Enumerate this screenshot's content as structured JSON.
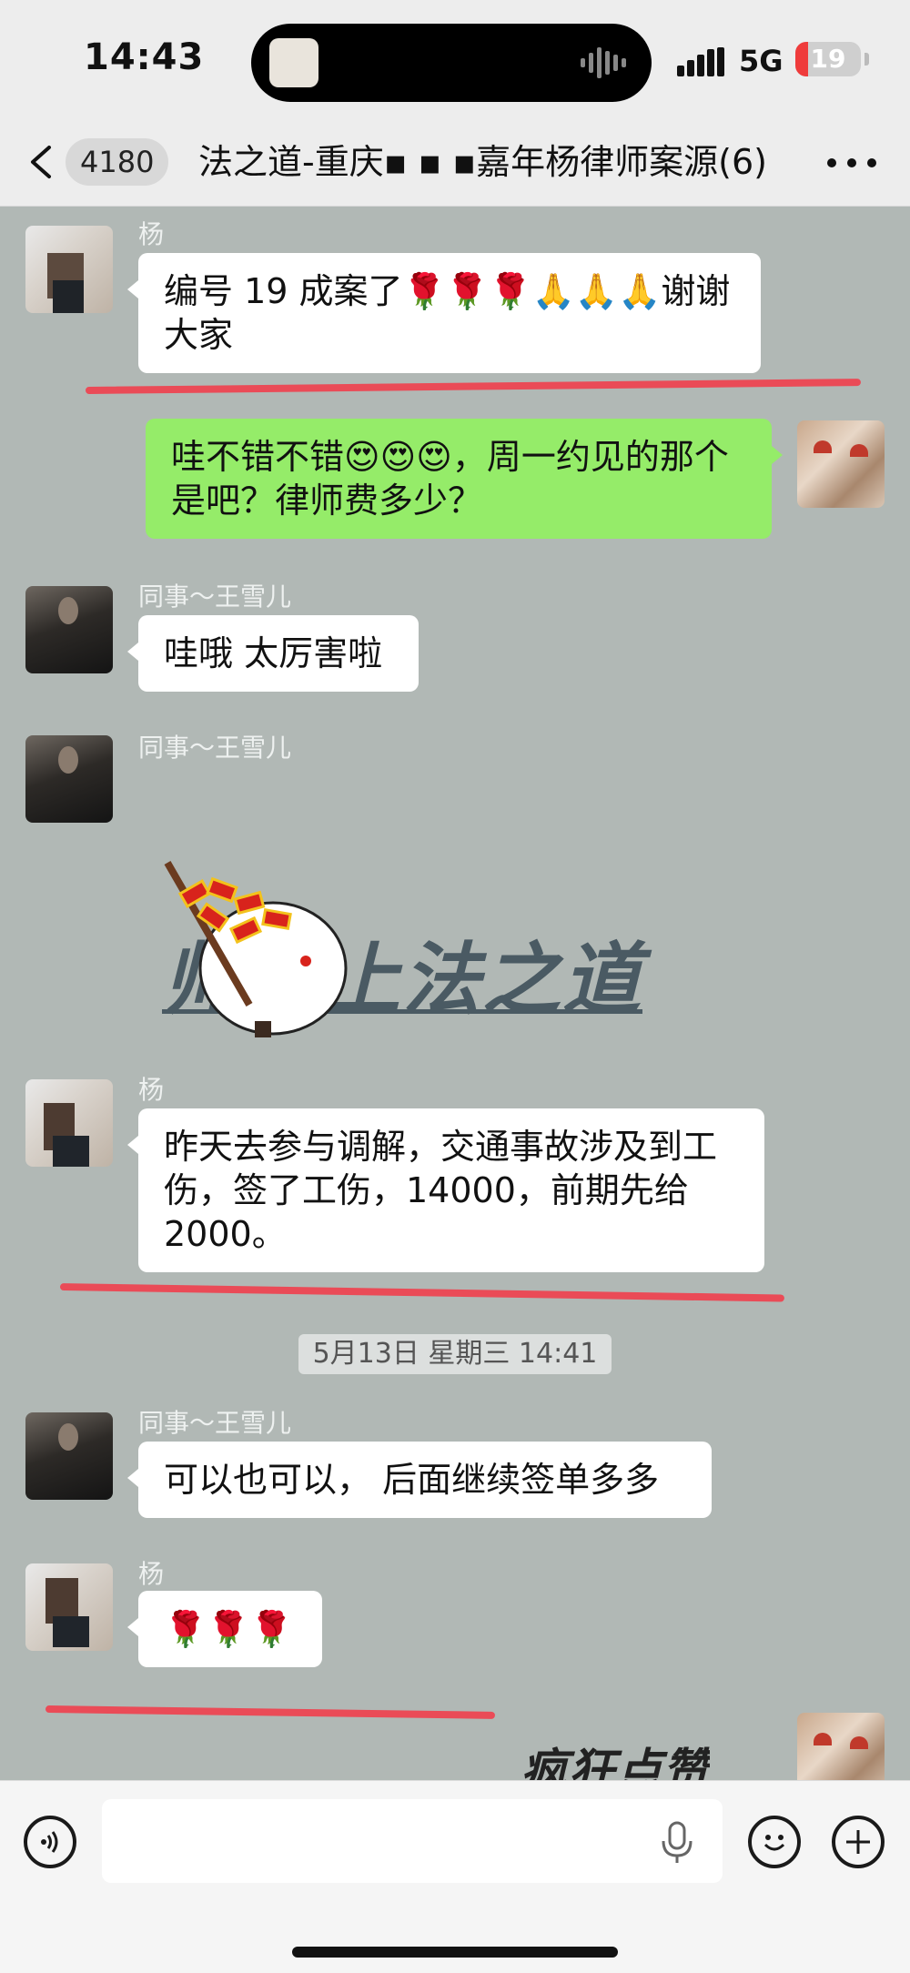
{
  "status_bar": {
    "time": "14:43",
    "network": "5G",
    "battery": "19",
    "battery_level_percent": 19
  },
  "nav": {
    "unread_count": "4180",
    "title": "法之道-重庆▪ ▪ ▪嘉年杨律师案源(6)",
    "back_icon": "chevron-left-icon",
    "more_icon": "more-dots-icon"
  },
  "messages": [
    {
      "sender": "杨",
      "text": "编号 19 成案了🌹🌹🌹🙏🙏🙏谢谢大家"
    },
    {
      "text": "哇不错不错😍😍😍，周一约见的那个是吧？律师费多少？"
    },
    {
      "sender": "同事～王雪儿",
      "text": "哇哦 太厉害啦"
    },
    {
      "sender": "同事～王雪儿",
      "sticker_text": "师就上法之道",
      "sticker_icon": "firecracker-sticker-icon"
    },
    {
      "sender": "杨",
      "text": "昨天去参与调解，交通事故涉及到工伤，签了工伤，14000，前期先给2000。"
    },
    {
      "sender": "同事～王雪儿",
      "text": "可以也可以， 后面继续签单多多"
    },
    {
      "sender": "杨",
      "text": "🌹🌹🌹"
    },
    {
      "sticker_text": "疯狂点赞"
    }
  ],
  "timestamp": "5月13日 星期三 14:41",
  "input_bar": {
    "voice_icon": "voice-icon",
    "mic_icon": "mic-icon",
    "emoji_icon": "emoji-icon",
    "plus_icon": "plus-icon"
  },
  "colors": {
    "chat_background": "#b1b8b5",
    "self_bubble": "#95ec69",
    "annotation_line": "#ea4b57"
  }
}
